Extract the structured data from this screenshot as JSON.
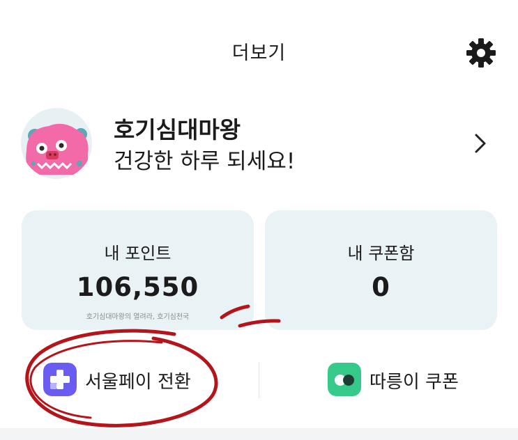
{
  "header": {
    "title": "더보기",
    "settings_icon": "gear-icon"
  },
  "profile": {
    "name": "호기심대마왕",
    "greeting": "건강한 하루 되세요!",
    "avatar_icon": "pink-monster-avatar",
    "chevron_icon": "chevron-right-icon"
  },
  "cards": {
    "points": {
      "label": "내 포인트",
      "value": "106,550",
      "note": "호기심대마왕의 열려라, 호기심천국"
    },
    "coupons": {
      "label": "내 쿠폰함",
      "value": "0"
    }
  },
  "actions": {
    "seoul_pay": {
      "label": "서울페이 전환",
      "icon": "plus-app-icon"
    },
    "ddareungi": {
      "label": "따릉이 쿠폰",
      "icon": "bike-app-icon"
    }
  },
  "colors": {
    "card_bg": "#e9f2f4",
    "seoul_pay_icon": "#6a5cf0",
    "ddareungi_icon": "#35c98a",
    "annotation": "#b3151b"
  }
}
